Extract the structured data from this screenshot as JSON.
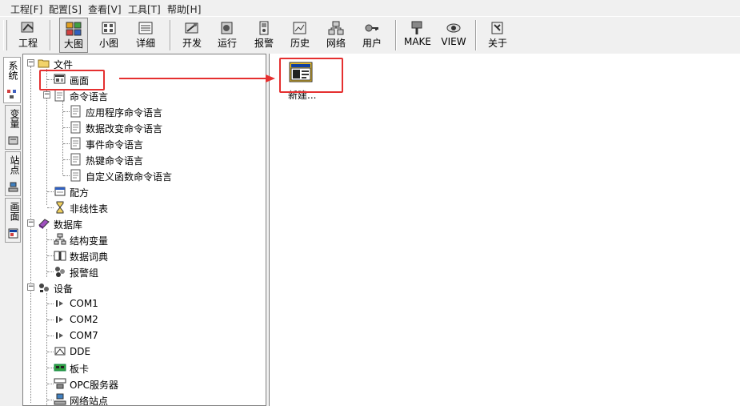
{
  "menu": [
    "工程[F]",
    "配置[S]",
    "查看[V]",
    "工具[T]",
    "帮助[H]"
  ],
  "toolbar": {
    "project": "工程",
    "large_icons": "大图",
    "small_icons": "小图",
    "details": "详细",
    "develop": "开发",
    "run": "运行",
    "alarm": "报警",
    "history": "历史",
    "network": "网络",
    "user": "用户",
    "make": "MAKE",
    "view": "VIEW",
    "about": "关于"
  },
  "side_tabs": [
    "系统",
    "变量",
    "站点",
    "画面"
  ],
  "tree": {
    "file": "文件",
    "screen": "画面",
    "command_lang": "命令语言",
    "app_cmd": "应用程序命令语言",
    "data_change_cmd": "数据改变命令语言",
    "event_cmd": "事件命令语言",
    "hotkey_cmd": "热键命令语言",
    "custom_func_cmd": "自定义函数命令语言",
    "recipe": "配方",
    "nonlinear_table": "非线性表",
    "database": "数据库",
    "struct_var": "结构变量",
    "data_dict": "数据词典",
    "alarm_group": "报警组",
    "device": "设备",
    "com1": "COM1",
    "com2": "COM2",
    "com7": "COM7",
    "dde": "DDE",
    "board": "板卡",
    "opc": "OPC服务器",
    "net_station": "网络站点"
  },
  "content": {
    "new_label": "新建..."
  },
  "colors": {
    "highlight": "#e53030"
  }
}
